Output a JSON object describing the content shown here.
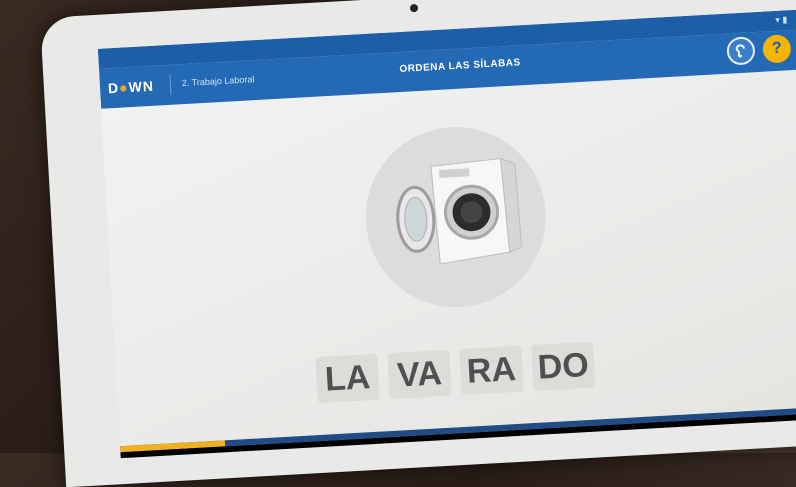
{
  "app": {
    "logo_text_prefix": "D",
    "logo_text_o": "●",
    "logo_text_suffix": "WN",
    "breadcrumb": "2. Trabajo Laboral",
    "title": "ORDENA LAS SÍLABAS",
    "accent_color": "#2469b4",
    "help_color": "#f4b400"
  },
  "toolbar": {
    "ear_icon": "ear-icon",
    "help_label": "?"
  },
  "exercise": {
    "image_subject": "washing-machine",
    "syllables": [
      "LA",
      "VA",
      "RA",
      "DO"
    ],
    "progress_fraction": 0.15
  },
  "navbar": {
    "back_glyph": "◁",
    "home_glyph": "○",
    "recents_glyph": "□"
  },
  "statusbar": {
    "icons_text": "▾ ▮"
  }
}
